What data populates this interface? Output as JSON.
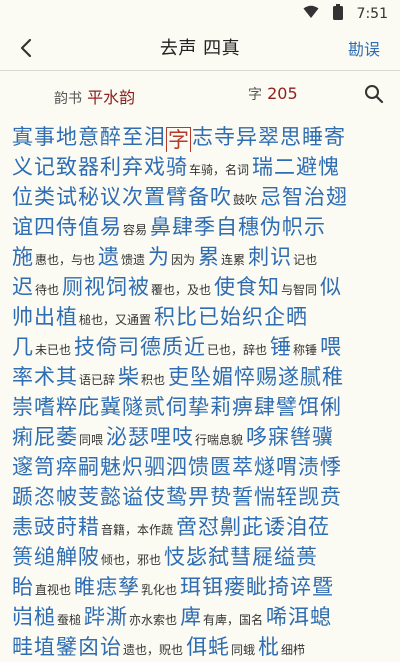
{
  "status": {
    "time": "7:51",
    "wifi_icon": "wifi-icon",
    "battery_icon": "battery-icon"
  },
  "toolbar": {
    "back_icon": "back-arrow-icon",
    "title": "去声 四真",
    "action": "勘误"
  },
  "meta": {
    "book_label": "韵书",
    "book_value": "平水韵",
    "char_label": "字",
    "char_count": "205",
    "search_icon": "search-icon"
  },
  "chars": [
    [
      {
        "t": "寘"
      },
      {
        "t": "事"
      },
      {
        "t": "地"
      },
      {
        "t": "意"
      },
      {
        "t": "醉"
      },
      {
        "t": "至"
      },
      {
        "t": "泪"
      },
      {
        "t": "字",
        "sel": true
      },
      {
        "t": "志"
      },
      {
        "t": "寺"
      },
      {
        "t": "异"
      },
      {
        "t": "翠"
      },
      {
        "t": "思"
      },
      {
        "t": "睡"
      },
      {
        "t": "寄"
      }
    ],
    [
      {
        "t": "义"
      },
      {
        "t": "记"
      },
      {
        "t": "致"
      },
      {
        "t": "器"
      },
      {
        "t": "利"
      },
      {
        "t": "弃"
      },
      {
        "t": "戏"
      },
      {
        "t": "骑",
        "n": "车骑，名词"
      },
      {
        "t": "瑞"
      },
      {
        "t": "二"
      },
      {
        "t": "避"
      },
      {
        "t": "愧"
      }
    ],
    [
      {
        "t": "位"
      },
      {
        "t": "类"
      },
      {
        "t": "试"
      },
      {
        "t": "秘"
      },
      {
        "t": "议"
      },
      {
        "t": "次"
      },
      {
        "t": "置"
      },
      {
        "t": "臂"
      },
      {
        "t": "备"
      },
      {
        "t": "吹",
        "n": "鼓吹"
      },
      {
        "t": "忌"
      },
      {
        "t": "智"
      },
      {
        "t": "治"
      },
      {
        "t": "翅"
      }
    ],
    [
      {
        "t": "谊"
      },
      {
        "t": "四"
      },
      {
        "t": "侍"
      },
      {
        "t": "值"
      },
      {
        "t": "易",
        "n": "容易"
      },
      {
        "t": "鼻"
      },
      {
        "t": "肆"
      },
      {
        "t": "季"
      },
      {
        "t": "自"
      },
      {
        "t": "穗"
      },
      {
        "t": "伪"
      },
      {
        "t": "帜"
      },
      {
        "t": "示"
      }
    ],
    [
      {
        "t": "施",
        "n": "惠也，与也"
      },
      {
        "t": "遗",
        "n": "馈遗"
      },
      {
        "t": "为",
        "n": "因为"
      },
      {
        "t": "累",
        "n": "连累"
      },
      {
        "t": "刺"
      },
      {
        "t": "识",
        "n": "记也"
      }
    ],
    [
      {
        "t": "迟",
        "n": "待也"
      },
      {
        "t": "厕"
      },
      {
        "t": "视"
      },
      {
        "t": "饲"
      },
      {
        "t": "被",
        "n": "覆也，及也"
      },
      {
        "t": "使"
      },
      {
        "t": "食"
      },
      {
        "t": "知",
        "n": "与智同"
      },
      {
        "t": "似"
      }
    ],
    [
      {
        "t": "帅"
      },
      {
        "t": "出"
      },
      {
        "t": "植",
        "n": "槌也，又通置"
      },
      {
        "t": "积"
      },
      {
        "t": "比"
      },
      {
        "t": "已"
      },
      {
        "t": "始"
      },
      {
        "t": "织"
      },
      {
        "t": "企"
      },
      {
        "t": "晒"
      }
    ],
    [
      {
        "t": "几",
        "n": "未已也"
      },
      {
        "t": "技"
      },
      {
        "t": "倚"
      },
      {
        "t": "司"
      },
      {
        "t": "德"
      },
      {
        "t": "质"
      },
      {
        "t": "近",
        "n": "已也，辞也"
      },
      {
        "t": "锤",
        "n": "称锤"
      },
      {
        "t": "喂"
      }
    ],
    [
      {
        "t": "率"
      },
      {
        "t": "术"
      },
      {
        "t": "其",
        "n": "语已辞"
      },
      {
        "t": "柴",
        "n": "积也"
      },
      {
        "t": "吏"
      },
      {
        "t": "坠"
      },
      {
        "t": "媚"
      },
      {
        "t": "悴"
      },
      {
        "t": "赐"
      },
      {
        "t": "遂"
      },
      {
        "t": "腻"
      },
      {
        "t": "稚"
      }
    ],
    [
      {
        "t": "崇"
      },
      {
        "t": "嗜"
      },
      {
        "t": "粹"
      },
      {
        "t": "庇"
      },
      {
        "t": "冀"
      },
      {
        "t": "隧"
      },
      {
        "t": "贰"
      },
      {
        "t": "伺"
      },
      {
        "t": "挚"
      },
      {
        "t": "莉"
      },
      {
        "t": "痹"
      },
      {
        "t": "肆"
      },
      {
        "t": "譬"
      },
      {
        "t": "饵"
      },
      {
        "t": "俐"
      }
    ],
    [
      {
        "t": "痢"
      },
      {
        "t": "屁"
      },
      {
        "t": "萎",
        "n": "同喂"
      },
      {
        "t": "泌"
      },
      {
        "t": "瑟"
      },
      {
        "t": "哩"
      },
      {
        "t": "吱",
        "n": "行喘息貌"
      },
      {
        "t": "哆"
      },
      {
        "t": "寐"
      },
      {
        "t": "辔"
      },
      {
        "t": "骥"
      }
    ],
    [
      {
        "t": "邃"
      },
      {
        "t": "笥"
      },
      {
        "t": "瘁"
      },
      {
        "t": "嗣"
      },
      {
        "t": "魅"
      },
      {
        "t": "炽"
      },
      {
        "t": "驷"
      },
      {
        "t": "泗"
      },
      {
        "t": "馈"
      },
      {
        "t": "匮"
      },
      {
        "t": "萃"
      },
      {
        "t": "燧"
      },
      {
        "t": "喟"
      },
      {
        "t": "渍"
      },
      {
        "t": "悸"
      }
    ],
    [
      {
        "t": "踬"
      },
      {
        "t": "恣"
      },
      {
        "t": "帔"
      },
      {
        "t": "芰"
      },
      {
        "t": "懿"
      },
      {
        "t": "谥"
      },
      {
        "t": "伎"
      },
      {
        "t": "鸷"
      },
      {
        "t": "畀"
      },
      {
        "t": "贽"
      },
      {
        "t": "誓"
      },
      {
        "t": "惴"
      },
      {
        "t": "轾"
      },
      {
        "t": "觊"
      },
      {
        "t": "贲"
      }
    ],
    [
      {
        "t": "恚"
      },
      {
        "t": "豉"
      },
      {
        "t": "莳"
      },
      {
        "t": "耤",
        "n": "音籍，本作蔬"
      },
      {
        "t": "啻"
      },
      {
        "t": "怼"
      },
      {
        "t": "劓"
      },
      {
        "t": "茈"
      },
      {
        "t": "诿"
      },
      {
        "t": "洎"
      },
      {
        "t": "莅"
      }
    ],
    [
      {
        "t": "篑"
      },
      {
        "t": "缒"
      },
      {
        "t": "觯"
      },
      {
        "t": "陂",
        "n": "倾也，邪也"
      },
      {
        "t": "忮"
      },
      {
        "t": "毖"
      },
      {
        "t": "弑"
      },
      {
        "t": "彗"
      },
      {
        "t": "屣"
      },
      {
        "t": "缢"
      },
      {
        "t": "蒉"
      }
    ],
    [
      {
        "t": "眙",
        "n": "直视也"
      },
      {
        "t": "睢"
      },
      {
        "t": "痣"
      },
      {
        "t": "孳",
        "n": "乳化也"
      },
      {
        "t": "珥"
      },
      {
        "t": "铒"
      },
      {
        "t": "瘘"
      },
      {
        "t": "眦"
      },
      {
        "t": "掎"
      },
      {
        "t": "谇"
      },
      {
        "t": "暨"
      }
    ],
    [
      {
        "t": "岿"
      },
      {
        "t": "槌",
        "n": "蚕槌"
      },
      {
        "t": "跸"
      },
      {
        "t": "澌",
        "n": "亦水索也"
      },
      {
        "t": "庳",
        "n": "有庳，国名"
      },
      {
        "t": "唏"
      },
      {
        "t": "洱"
      },
      {
        "t": "螅"
      }
    ],
    [
      {
        "t": "畦"
      },
      {
        "t": "埴"
      },
      {
        "t": "鐾"
      },
      {
        "t": "囟"
      },
      {
        "t": "诒",
        "n": "遗也，贶也"
      },
      {
        "t": "佴"
      },
      {
        "t": "蚝",
        "n": "同蛾"
      },
      {
        "t": "枇",
        "n": "细栉"
      }
    ]
  ]
}
